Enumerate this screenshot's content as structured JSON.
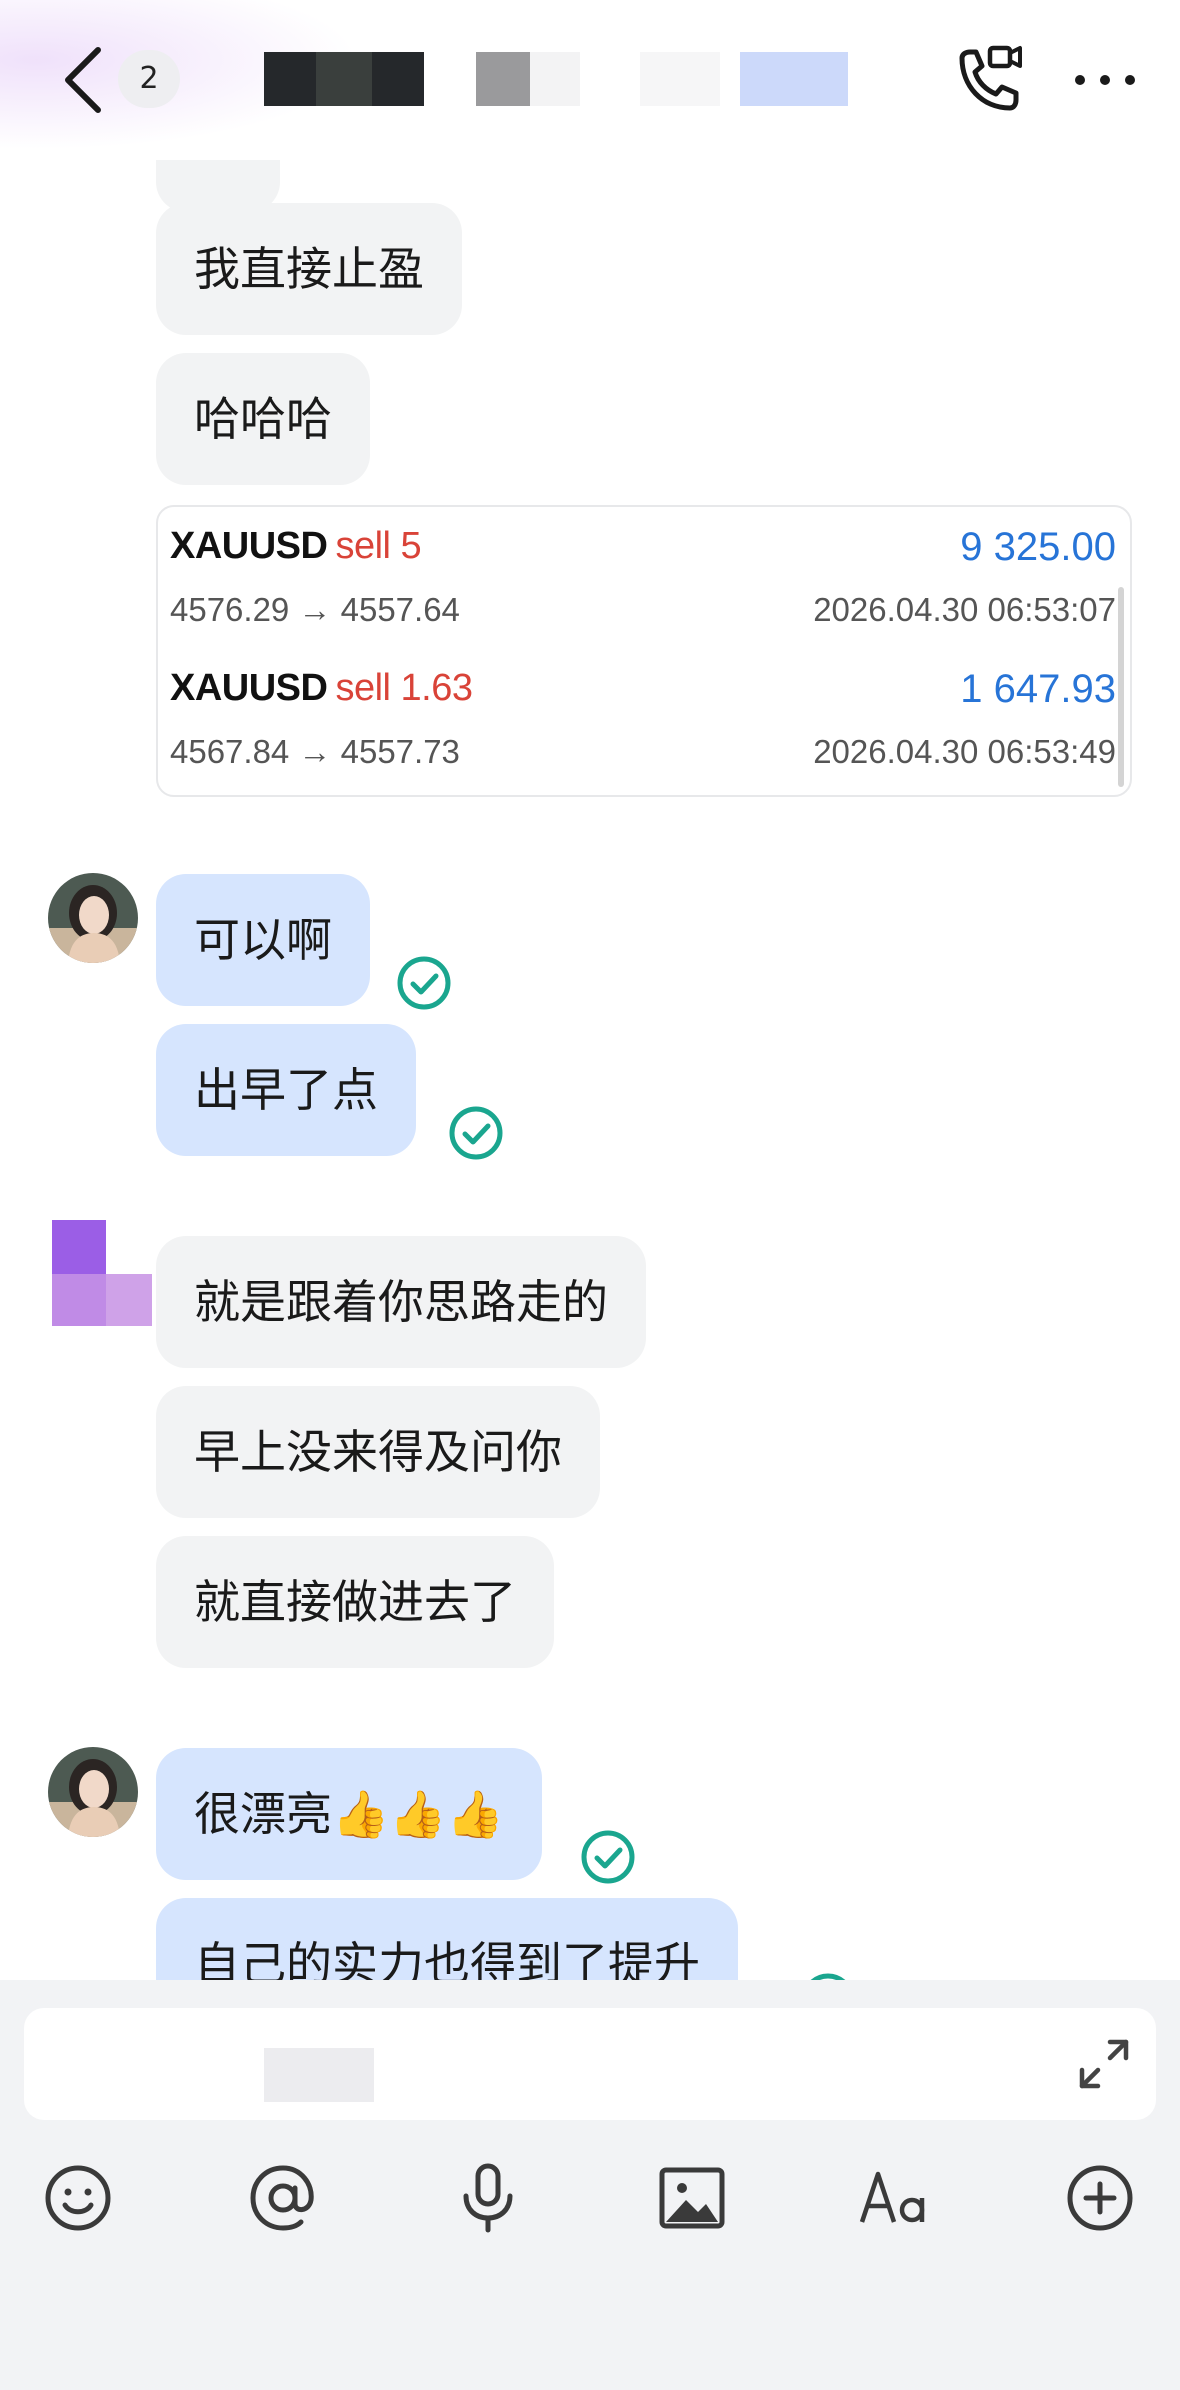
{
  "header": {
    "unread_count": "2",
    "colors": {
      "glow": "#eedefa"
    }
  },
  "messages": [
    {
      "id": "m0",
      "side": "received",
      "text": ""
    },
    {
      "id": "m1",
      "side": "received",
      "text": "我直接止盈"
    },
    {
      "id": "m2",
      "side": "received",
      "text": "哈哈哈"
    },
    {
      "id": "m4",
      "side": "sent",
      "text": "可以啊",
      "status": "read"
    },
    {
      "id": "m5",
      "side": "sent",
      "text": "出早了点",
      "status": "read"
    },
    {
      "id": "m6",
      "side": "received",
      "text": "就是跟着你思路走的"
    },
    {
      "id": "m7",
      "side": "received",
      "text": "早上没来得及问你"
    },
    {
      "id": "m8",
      "side": "received",
      "text": "就直接做进去了"
    },
    {
      "id": "m9",
      "side": "sent",
      "text": "很漂亮👍👍👍",
      "status": "read"
    },
    {
      "id": "m10",
      "side": "sent",
      "text": "自己的实力也得到了提升",
      "status": "read"
    }
  ],
  "trade_card": {
    "trades": [
      {
        "symbol": "XAUUSD",
        "side": "sell 5",
        "profit": "9 325.00",
        "prices": "4576.29 → 4557.64",
        "time": "2026.04.30 06:53:07"
      },
      {
        "symbol": "XAUUSD",
        "side": "sell 1.63",
        "profit": "1 647.93",
        "prices": "4567.84 → 4557.73",
        "time": "2026.04.30 06:53:49"
      }
    ]
  },
  "composer": {
    "draft_text": "",
    "tools": [
      "emoji-icon",
      "mention-icon",
      "microphone-icon",
      "image-icon",
      "text-format-icon",
      "plus-icon"
    ]
  },
  "colors": {
    "sent_bubble": "#d6e5fe",
    "received_bubble": "#f2f3f4",
    "read_check": "#1aa68f",
    "sell": "#d94338",
    "profit": "#2774d7",
    "composer_bg": "#f2f3f5"
  }
}
